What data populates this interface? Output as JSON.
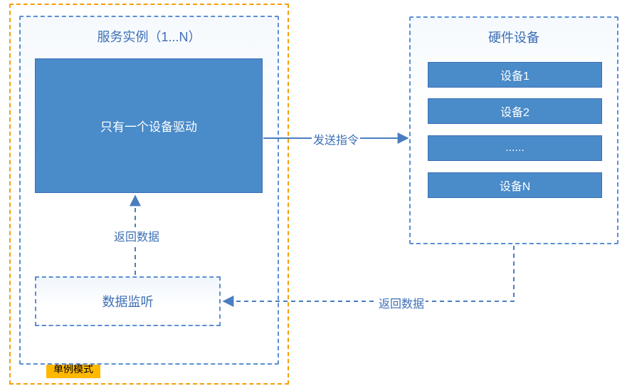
{
  "singleton": {
    "label": "单例模式"
  },
  "service": {
    "title": "服务实例（1...N）",
    "driver": "只有一个设备驱动",
    "listener": "数据监听"
  },
  "hardware": {
    "title": "硬件设备",
    "devices": [
      "设备1",
      "设备2",
      "......",
      "设备N"
    ]
  },
  "edges": {
    "send_cmd": "发送指令",
    "return_to_driver": "返回数据",
    "return_to_listener": "返回数据"
  },
  "colors": {
    "blue_fill": "#4a8bc9",
    "blue_line": "#5b8fd4",
    "orange": "#f59e0b",
    "orange_label_bg": "#ffb800"
  }
}
